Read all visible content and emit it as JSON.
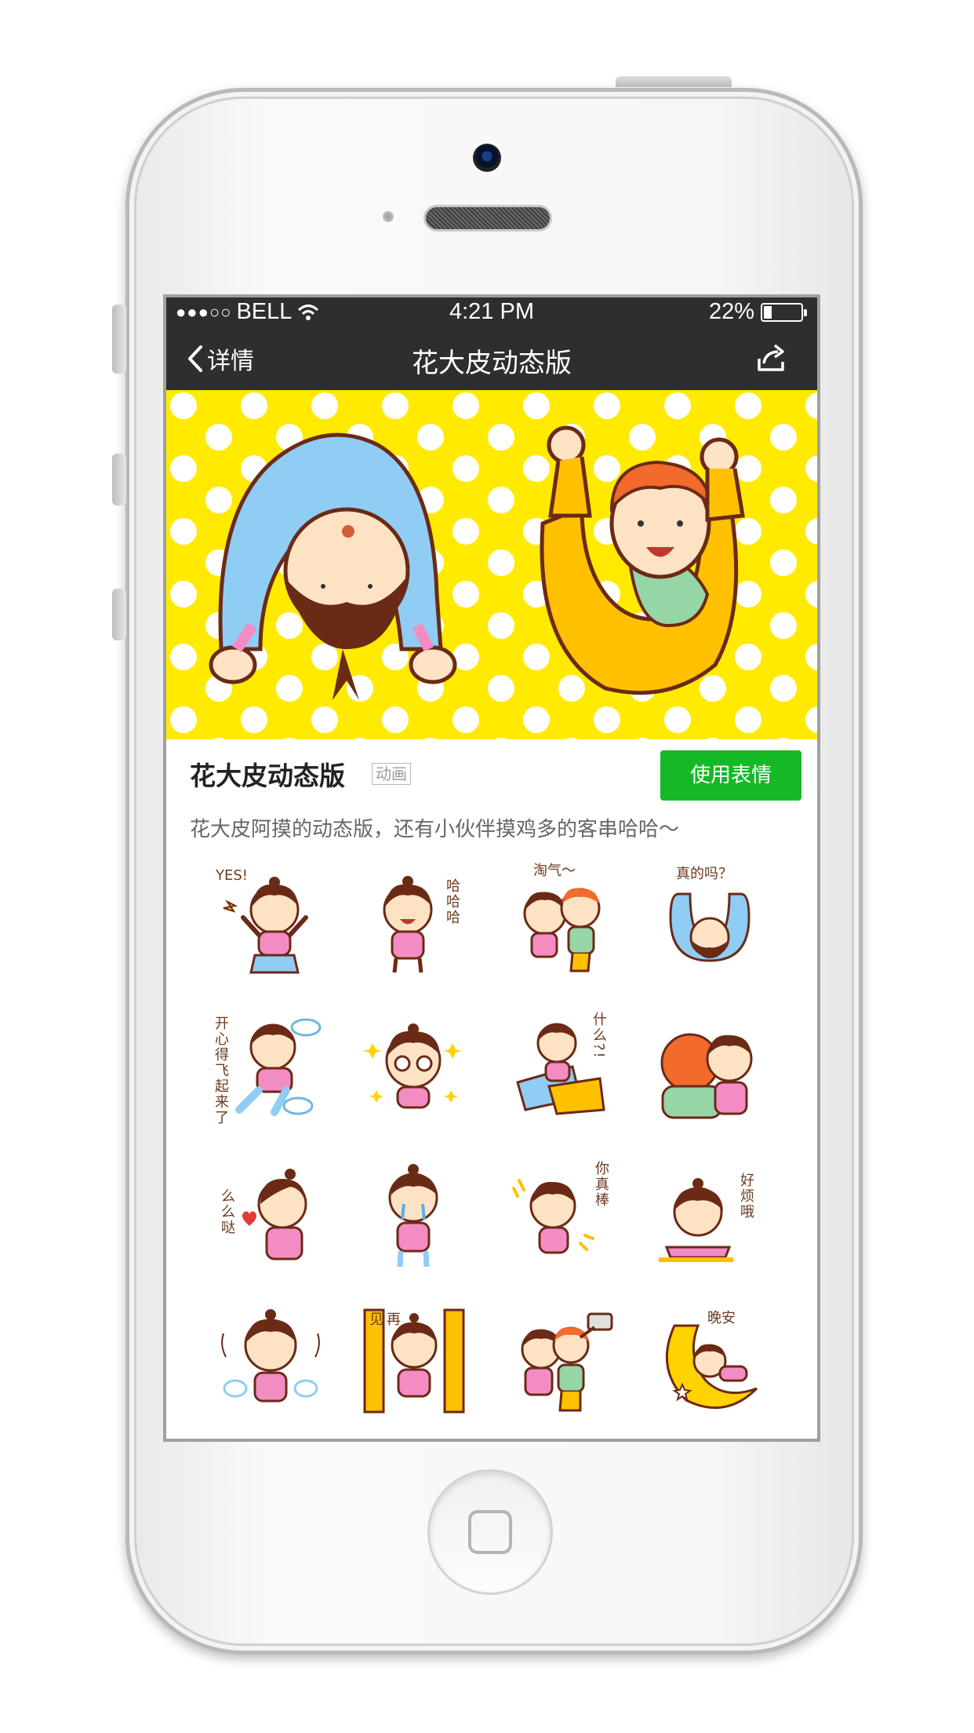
{
  "status_bar": {
    "signal": "●●●○○",
    "carrier": "BELL",
    "time": "4:21 PM",
    "battery_percent": "22%",
    "battery_level": 0.22
  },
  "nav": {
    "back_label": "详情",
    "title": "花大皮动态版"
  },
  "package": {
    "title": "花大皮动态版",
    "tag": "动画",
    "use_button": "使用表情",
    "description": "花大皮阿摸的动态版，还有小伙伴摸鸡多的客串哈哈～"
  },
  "stickers": [
    {
      "text": "YES!"
    },
    {
      "text": "哈哈哈"
    },
    {
      "text": "淘气～"
    },
    {
      "text": "真的吗？"
    },
    {
      "text": "开心得飞起来了"
    },
    {
      "text": ""
    },
    {
      "text": "什么?!"
    },
    {
      "text": ""
    },
    {
      "text": "么么哒"
    },
    {
      "text": ""
    },
    {
      "text": "你真棒"
    },
    {
      "text": "好烦哦"
    },
    {
      "text": ""
    },
    {
      "text": "再见"
    },
    {
      "text": ""
    },
    {
      "text": "晚安"
    }
  ],
  "colors": {
    "nav_bg": "#2e2e30",
    "banner_bg": "#ffea00",
    "use_button": "#16b826",
    "skin": "#fde3c4",
    "hair": "#6b2a16",
    "pink": "#f48cc4",
    "blue": "#8fcdf5"
  }
}
